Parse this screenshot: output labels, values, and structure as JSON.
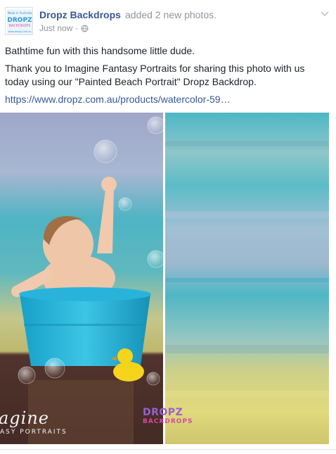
{
  "post": {
    "page_name": "Dropz Backdrops",
    "action": "added 2 new photos.",
    "time": "Just now",
    "separator": "·",
    "privacy_icon": "globe-icon",
    "options_icon": "chevron-down-icon",
    "avatar_lines": [
      "Made in Australia",
      "DROPZ",
      "BACKDROPS",
      "www.dropz.com.au"
    ],
    "text_line_1": "Bathtime fun with this handsome little dude.",
    "text_line_2": "Thank you to Imagine Fantasy Portraits for sharing this photo with us",
    "text_line_3": "today using our \"Painted Beach Portrait\" Dropz Backdrop.",
    "link": "https://www.dropz.com.au/products/watercolor-59…",
    "photo_watermark_left": "agine",
    "photo_watermark_left_sub": "ASY PORTRAITS",
    "photo_watermark_right_1": "DROPZ",
    "photo_watermark_right_2": "BACKDROPS"
  },
  "colors": {
    "link_blue": "#365899",
    "meta_grey": "#90949c",
    "text": "#1d2129"
  }
}
